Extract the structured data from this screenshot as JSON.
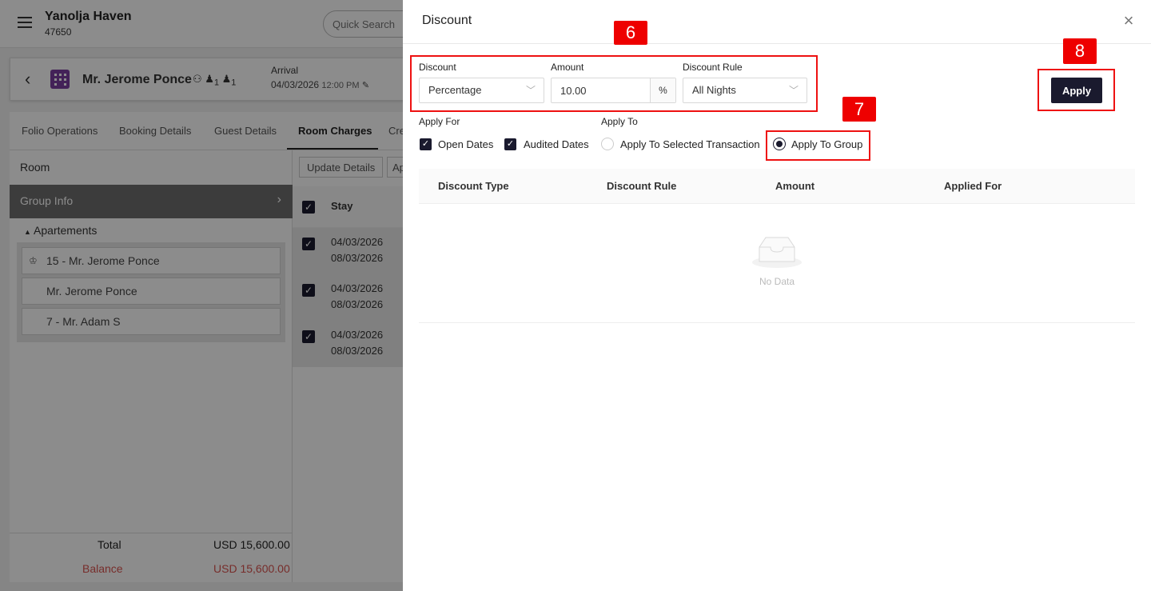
{
  "app": {
    "hotel_name": "Yanolja Haven",
    "hotel_id": "47650",
    "quick_search_placeholder": "Quick Search"
  },
  "guest": {
    "name": "Mr. Jerome Ponce",
    "adults": "1",
    "children": "1",
    "arrival_label": "Arrival",
    "arrival_date": "04/03/2026",
    "arrival_time": "12:00 PM"
  },
  "tabs": [
    "Folio Operations",
    "Booking Details",
    "Guest Details",
    "Room Charges",
    "Cre"
  ],
  "left_panel": {
    "room_label": "Room",
    "group_info": "Group Info",
    "apartments": "Apartements",
    "rooms": [
      "15 - Mr. Jerome Ponce",
      "Mr. Jerome Ponce",
      "7 - Mr. Adam S"
    ],
    "total_label": "Total",
    "total_value": "USD 15,600.00",
    "balance_label": "Balance",
    "balance_value": "USD 15,600.00"
  },
  "mid_panel": {
    "update_details": "Update Details",
    "ap_button": "Ap",
    "stay_header": "Stay",
    "rows": [
      {
        "from": "04/03/2026",
        "to": "08/03/2026"
      },
      {
        "from": "04/03/2026",
        "to": "08/03/2026"
      },
      {
        "from": "04/03/2026",
        "to": "08/03/2026"
      }
    ]
  },
  "drawer": {
    "title": "Discount",
    "discount_label": "Discount",
    "discount_value": "Percentage",
    "amount_label": "Amount",
    "amount_value": "10.00",
    "amount_addon": "%",
    "rule_label": "Discount Rule",
    "rule_value": "All Nights",
    "apply_button": "Apply",
    "apply_for_label": "Apply For",
    "open_dates": "Open Dates",
    "audited_dates": "Audited Dates",
    "apply_to_label": "Apply To",
    "apply_selected": "Apply To Selected Transaction",
    "apply_group": "Apply To Group",
    "columns": [
      "Discount Type",
      "Discount Rule",
      "Amount",
      "Applied For"
    ],
    "empty_text": "No Data"
  },
  "annotations": [
    "6",
    "7",
    "8"
  ],
  "colors": {
    "primary": "#1a1a2e",
    "annotation": "#e00000",
    "balance": "#d9534f",
    "group_info_bg": "#6e6e6e"
  }
}
